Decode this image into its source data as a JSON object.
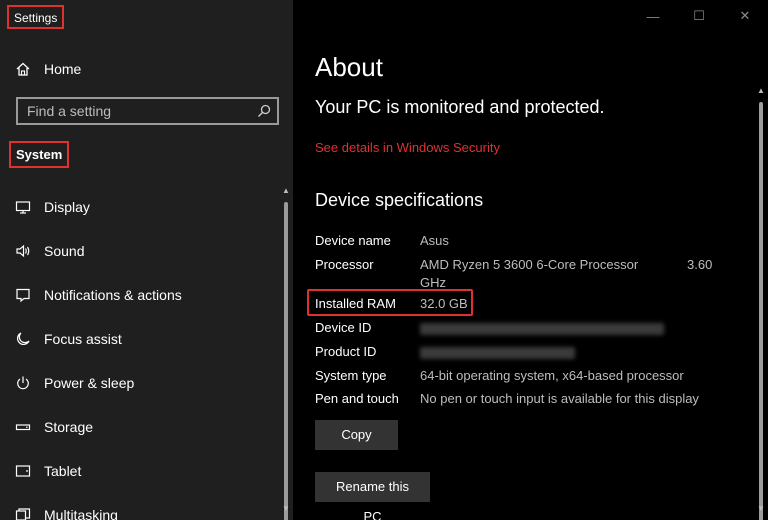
{
  "app": {
    "title": "Settings"
  },
  "sidebar": {
    "home_label": "Home",
    "search_placeholder": "Find a setting",
    "section_title": "System",
    "items": [
      {
        "label": "Display",
        "icon": "monitor-icon"
      },
      {
        "label": "Sound",
        "icon": "speaker-icon"
      },
      {
        "label": "Notifications & actions",
        "icon": "notification-icon"
      },
      {
        "label": "Focus assist",
        "icon": "moon-icon"
      },
      {
        "label": "Power & sleep",
        "icon": "power-icon"
      },
      {
        "label": "Storage",
        "icon": "storage-icon"
      },
      {
        "label": "Tablet",
        "icon": "tablet-icon"
      },
      {
        "label": "Multitasking",
        "icon": "multitasking-icon"
      }
    ]
  },
  "window_controls": {
    "minimize": "—",
    "maximize": "☐",
    "close": "✕"
  },
  "main": {
    "title": "About",
    "protection_status": "Your PC is monitored and protected.",
    "security_link": "See details in Windows Security",
    "specs_heading": "Device specifications",
    "specs": {
      "device_name": {
        "label": "Device name",
        "value": "Asus"
      },
      "processor": {
        "label": "Processor",
        "value": "AMD Ryzen 5 3600 6-Core Processor",
        "value_suffix": "GHz",
        "speed": "3.60"
      },
      "ram": {
        "label": "Installed RAM",
        "value": "32.0 GB"
      },
      "device_id": {
        "label": "Device ID"
      },
      "product_id": {
        "label": "Product ID"
      },
      "system_type": {
        "label": "System type",
        "value": "64-bit operating system, x64-based processor"
      },
      "pen_touch": {
        "label": "Pen and touch",
        "value": "No pen or touch input is available for this display"
      }
    },
    "copy_button": "Copy",
    "rename_button": "Rename this PC"
  },
  "colors": {
    "accent_red": "#e03131",
    "sidebar_bg": "#1f1f1f",
    "content_bg": "#000000",
    "button_bg": "#333333"
  }
}
